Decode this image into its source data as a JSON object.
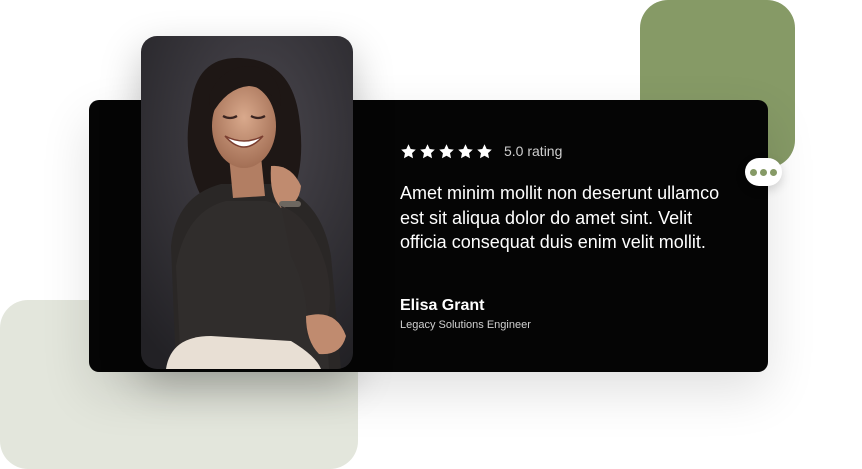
{
  "colors": {
    "card_bg": "#050505",
    "accent_green": "#869a66",
    "sage_bg": "#e3e6dc",
    "star": "#ffffff",
    "dots": "#869a66"
  },
  "testimonial": {
    "stars": 5,
    "rating_label": "5.0 rating",
    "quote": "Amet minim mollit non deserunt ullamco est sit aliqua dolor do amet sint. Velit officia consequat duis enim velit mollit.",
    "author_name": "Elisa Grant",
    "author_title": "Legacy Solutions Engineer"
  },
  "icons": {
    "star": "star-icon",
    "more": "more-dots-icon"
  }
}
